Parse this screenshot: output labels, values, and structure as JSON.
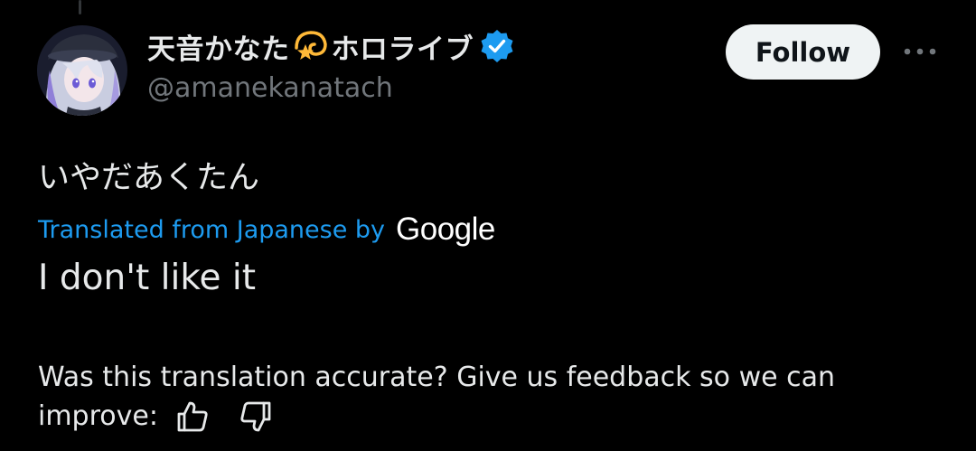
{
  "author": {
    "display_name": "天音かなた",
    "display_name_suffix": "ホロライブ",
    "handle": "@amanekanatach",
    "name_emoji": "dizzy-star-emoji",
    "verified_icon": "verified-badge-icon"
  },
  "follow_button": {
    "label": "Follow"
  },
  "more_icon": "more-options-icon",
  "post": {
    "original_text": "いやだあくたん",
    "translated_label": "Translated from Japanese by",
    "translator_brand": "Google",
    "translation": "I don't like it"
  },
  "feedback": {
    "line1": "Was this translation accurate? Give us feedback so we can",
    "line2": "improve:",
    "thumbs_up_icon": "thumbs-up-icon",
    "thumbs_down_icon": "thumbs-down-icon"
  },
  "colors": {
    "background": "#000000",
    "text_primary": "#e7e9ea",
    "text_secondary": "#71767b",
    "link_blue": "#1d9bf0",
    "verified_blue": "#1d9bf0",
    "follow_bg": "#eff3f4",
    "follow_text": "#0f1419"
  }
}
